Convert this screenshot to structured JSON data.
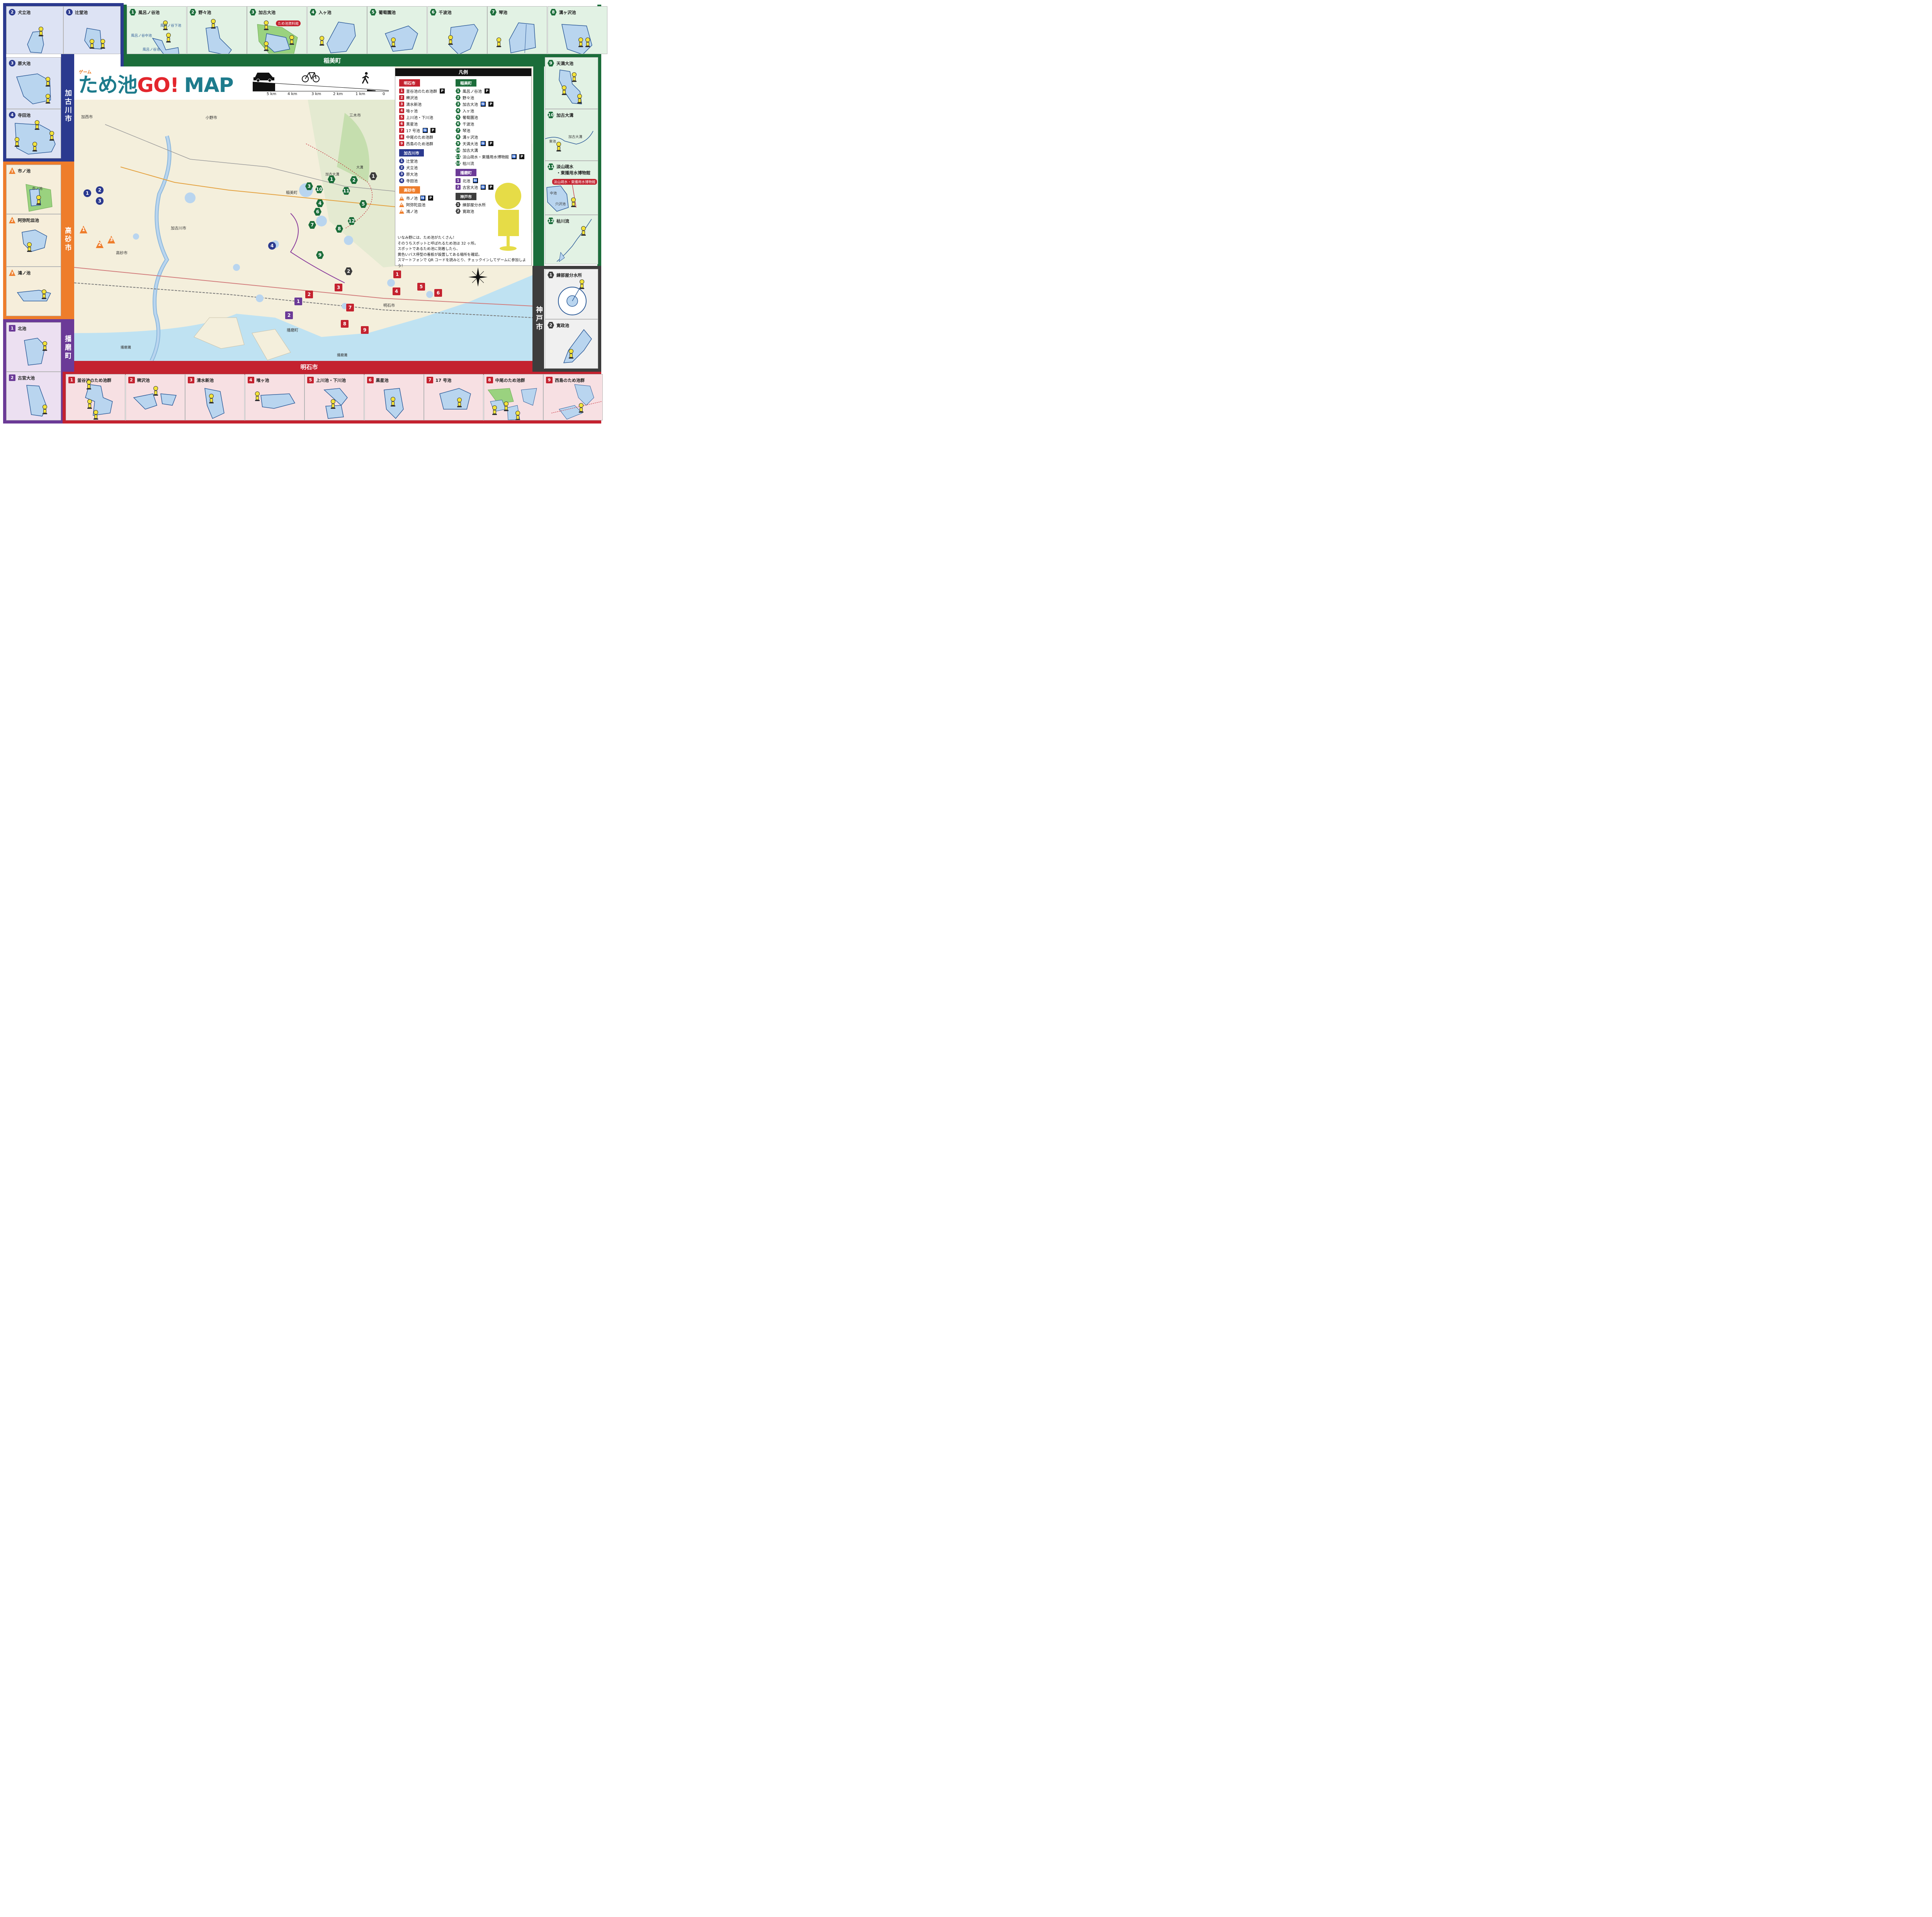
{
  "title": {
    "small": "ゲーム",
    "main_a": "ため池",
    "main_b": "GO!",
    "main_c": "MAP"
  },
  "scale": {
    "labels": [
      "5 km",
      "4 km",
      "3 km",
      "2 km",
      "1 km",
      "0"
    ],
    "icons": [
      "car-icon",
      "bicycle-icon",
      "walker-icon"
    ]
  },
  "regions": {
    "inami": {
      "label": "稲美町",
      "color": "#1b6d3a",
      "panel_bg": "#e2f2e4"
    },
    "kakogawa": {
      "label": "加古川市",
      "color": "#2b3a8f",
      "panel_bg": "#dde3f4"
    },
    "takasago": {
      "label": "高砂市",
      "color": "#ee7d2b",
      "panel_bg": "#f6eedb"
    },
    "harima": {
      "label": "播磨町",
      "color": "#6b3a97",
      "panel_bg": "#ece0f1"
    },
    "akashi": {
      "label": "明石市",
      "color": "#c4222f",
      "panel_bg": "#f7e0e3"
    },
    "kobe": {
      "label": "神戸市",
      "color": "#3d3d3d",
      "panel_bg": "#f0f0f0"
    }
  },
  "panels": {
    "kakogawa_top": [
      {
        "n": "2",
        "name": "犬立池"
      },
      {
        "n": "1",
        "name": "辻堂池"
      }
    ],
    "kakogawa_side": [
      {
        "n": "3",
        "name": "原大池"
      },
      {
        "n": "4",
        "name": "寺田池"
      }
    ],
    "inami_top": [
      {
        "n": "1",
        "name": "風呂ノ谷池"
      },
      {
        "n": "2",
        "name": "野々池"
      },
      {
        "n": "3",
        "name": "加古大池"
      },
      {
        "n": "4",
        "name": "入ヶ池"
      },
      {
        "n": "5",
        "name": "葡萄園池"
      },
      {
        "n": "6",
        "name": "千波池"
      },
      {
        "n": "7",
        "name": "琴池"
      },
      {
        "n": "8",
        "name": "溝ヶ沢池"
      }
    ],
    "inami_side": [
      {
        "n": "9",
        "name": "天満大池"
      },
      {
        "n": "10",
        "name": "加古大溝"
      },
      {
        "n": "11",
        "name": "淡山疏水\n・東播用水博物館"
      },
      {
        "n": "12",
        "name": "枯川流"
      }
    ],
    "takasago": [
      {
        "n": "1",
        "name": "市ノ池"
      },
      {
        "n": "2",
        "name": "阿弥陀皿池"
      },
      {
        "n": "3",
        "name": "鴻ノ池"
      }
    ],
    "harima": [
      {
        "n": "1",
        "name": "北池"
      },
      {
        "n": "2",
        "name": "古宮大池"
      }
    ],
    "kobe": [
      {
        "n": "1",
        "name": "練部屋分水所"
      },
      {
        "n": "2",
        "name": "寛政池"
      }
    ],
    "akashi": [
      {
        "n": "1",
        "name": "釜谷池のため池群"
      },
      {
        "n": "2",
        "name": "稗沢池"
      },
      {
        "n": "3",
        "name": "清水新池"
      },
      {
        "n": "4",
        "name": "喰ヶ池"
      },
      {
        "n": "5",
        "name": "上川池・下川池"
      },
      {
        "n": "6",
        "name": "黒星池"
      },
      {
        "n": "7",
        "name": "17 号池"
      },
      {
        "n": "8",
        "name": "中尾のため池群"
      },
      {
        "n": "9",
        "name": "西島のため池群"
      }
    ]
  },
  "panel_labels": {
    "furo": [
      "風呂ノ谷下池",
      "風呂ノ谷中池",
      "風呂ノ谷池"
    ],
    "kako_museum": "ため池資料館",
    "kakoomizo": [
      "東池",
      "加古大溝"
    ],
    "tanzan": "淡山疏水・東播用水博物館",
    "tanzan_sub": [
      "中池",
      "穴沢池"
    ],
    "ichino": [
      "市ノ池",
      "池"
    ],
    "kamaya": [
      "岩蛇池",
      "中笠池",
      "稲葉池",
      "釜谷池"
    ],
    "hiezawa": [
      "皿池",
      "稗沢池"
    ],
    "kamikawa": [
      "上川池",
      "下川池"
    ],
    "nakao": [
      "中尾親水公園",
      "新池",
      "長谷池",
      "尻ノ池",
      "皿池"
    ],
    "nishijima": [
      "切池",
      "下切池",
      "納戸池",
      "上池",
      "大池",
      "三池"
    ]
  },
  "legend": {
    "title": "凡例",
    "akashi": {
      "head": "明石市",
      "items": [
        {
          "n": "1",
          "name": "釜谷池のため池群",
          "tags": [
            "P"
          ]
        },
        {
          "n": "2",
          "name": "稗沢池",
          "tags": []
        },
        {
          "n": "3",
          "name": "清水新池",
          "tags": []
        },
        {
          "n": "4",
          "name": "喰ヶ池",
          "tags": []
        },
        {
          "n": "5",
          "name": "上川池・下川池",
          "tags": []
        },
        {
          "n": "6",
          "name": "黒星池",
          "tags": []
        },
        {
          "n": "7",
          "name": "17 号池",
          "tags": [
            "WC",
            "P"
          ]
        },
        {
          "n": "8",
          "name": "中尾のため池群",
          "tags": []
        },
        {
          "n": "9",
          "name": "西島のため池群",
          "tags": []
        }
      ]
    },
    "kakogawa": {
      "head": "加古川市",
      "items": [
        {
          "n": "1",
          "name": "辻堂池",
          "tags": []
        },
        {
          "n": "2",
          "name": "犬立池",
          "tags": []
        },
        {
          "n": "3",
          "name": "原大池",
          "tags": []
        },
        {
          "n": "4",
          "name": "寺田池",
          "tags": []
        }
      ]
    },
    "takasago": {
      "head": "高砂市",
      "items": [
        {
          "n": "1",
          "name": "市ノ池",
          "tags": [
            "WC",
            "P"
          ]
        },
        {
          "n": "2",
          "name": "阿弥陀皿池",
          "tags": []
        },
        {
          "n": "3",
          "name": "鴻ノ池",
          "tags": []
        }
      ]
    },
    "inami": {
      "head": "稲美町",
      "items": [
        {
          "n": "1",
          "name": "風呂ノ谷池",
          "tags": [
            "P"
          ]
        },
        {
          "n": "2",
          "name": "野々池",
          "tags": []
        },
        {
          "n": "3",
          "name": "加古大池",
          "tags": [
            "WC",
            "P"
          ]
        },
        {
          "n": "4",
          "name": "入ヶ池",
          "tags": []
        },
        {
          "n": "5",
          "name": "葡萄園池",
          "tags": []
        },
        {
          "n": "6",
          "name": "千波池",
          "tags": []
        },
        {
          "n": "7",
          "name": "琴池",
          "tags": []
        },
        {
          "n": "8",
          "name": "溝ヶ沢池",
          "tags": []
        },
        {
          "n": "9",
          "name": "天満大池",
          "tags": [
            "WC",
            "P"
          ]
        },
        {
          "n": "10",
          "name": "加古大溝",
          "tags": []
        },
        {
          "n": "11",
          "name": "淡山疏水・東播用水博物館",
          "tags": [
            "WC",
            "P"
          ]
        },
        {
          "n": "12",
          "name": "枯川流",
          "tags": []
        }
      ]
    },
    "harima": {
      "head": "播磨町",
      "items": [
        {
          "n": "1",
          "name": "北池",
          "tags": [
            "WC"
          ]
        },
        {
          "n": "2",
          "name": "古宮大池",
          "tags": [
            "WC",
            "P"
          ]
        }
      ]
    },
    "kobe": {
      "head": "神戸市",
      "items": [
        {
          "n": "1",
          "name": "練部屋分水所",
          "tags": []
        },
        {
          "n": "2",
          "name": "寛政池",
          "tags": []
        }
      ]
    },
    "note": [
      "いなみ野には、ため池がたくさん！",
      "そのうちスポットと呼ばれるため池は 32 ヶ所。",
      "スポットであるため池に到着したら、",
      "黄色いバス停型の看板が設置してある場所を確認。",
      "スマートフォンで QR コードを読みとり、チェックインしてゲームに参加しよう！"
    ]
  },
  "map_labels": {
    "cities": [
      "小野市",
      "加西市",
      "三木市",
      "稲美町",
      "加古川市",
      "高砂市",
      "明石市",
      "播磨町",
      "加古大溝",
      "大溝"
    ],
    "sea": [
      "播磨灘",
      "播磨灘"
    ]
  },
  "map_markers": {
    "kakogawa": [
      "1",
      "2",
      "3",
      "4"
    ],
    "takasago": [
      "1",
      "2",
      "3"
    ],
    "inami": [
      "1",
      "2",
      "3",
      "4",
      "5",
      "6",
      "7",
      "8",
      "9",
      "10",
      "11",
      "12"
    ],
    "akashi": [
      "1",
      "2",
      "3",
      "4",
      "5",
      "6",
      "7",
      "8",
      "9"
    ],
    "harima": [
      "1",
      "2"
    ],
    "kobe": [
      "1",
      "2"
    ]
  },
  "compass": "compass-icon",
  "signboard": "bus-stop-sign-icon"
}
